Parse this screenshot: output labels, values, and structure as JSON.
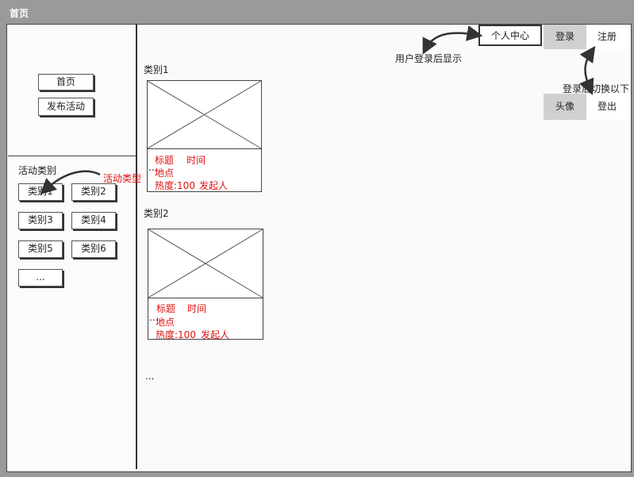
{
  "window": {
    "title": "首页"
  },
  "sidebar": {
    "nav": [
      {
        "label": "首页"
      },
      {
        "label": "发布活动"
      }
    ],
    "section_title": "活动类别",
    "categories": [
      "类别1",
      "类别2",
      "类别3",
      "类别4",
      "类别5",
      "类别6"
    ],
    "more": "..."
  },
  "header": {
    "profile": "个人中心",
    "login": "登录",
    "register": "注册",
    "avatar": "头像",
    "logout": "登出"
  },
  "annotations": {
    "profile_note": "用户登录后显示",
    "login_note": "登录后切换以下",
    "category_note": "活动类型"
  },
  "main": {
    "sections": [
      {
        "title": "类别1",
        "card": {
          "title": "标题",
          "time": "时间",
          "place": "地点",
          "heat": "热度:100",
          "creator": "发起人",
          "more": "..."
        }
      },
      {
        "title": "类别2",
        "card": {
          "title": "标题",
          "time": "时间",
          "place": "地点",
          "heat": "热度:100",
          "creator": "发起人",
          "more": "..."
        }
      }
    ],
    "more": "..."
  },
  "colors": {
    "accent_red": "#e01010",
    "gray_box": "#d0d0d0"
  }
}
